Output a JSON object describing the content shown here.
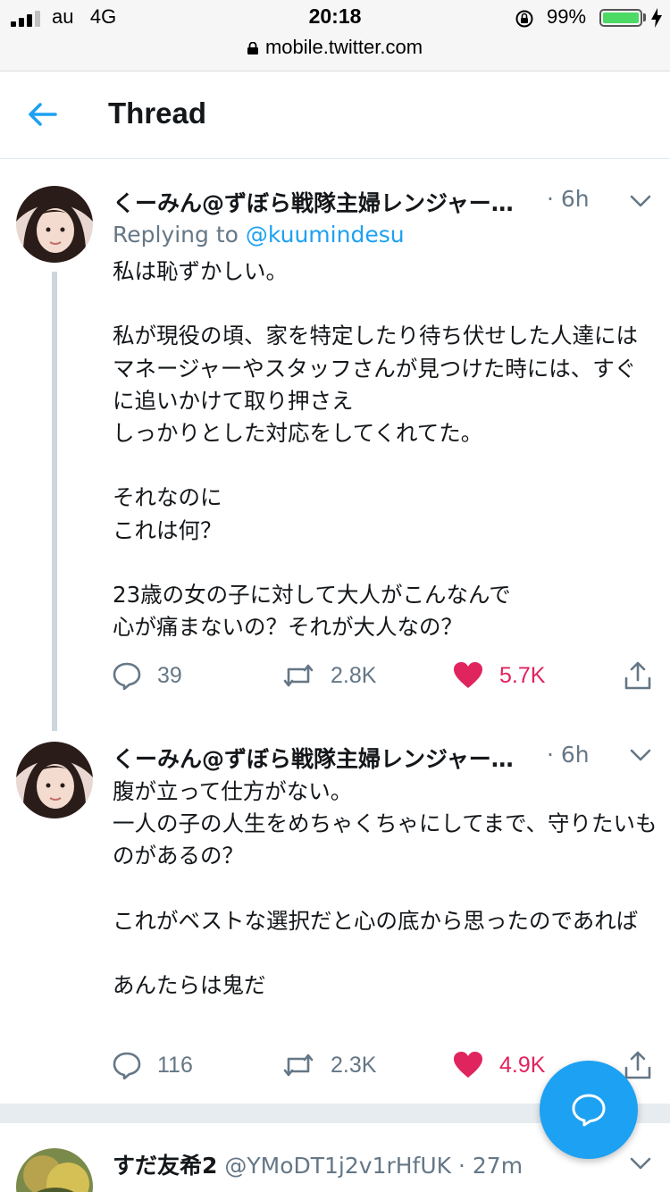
{
  "status_bar": {
    "carrier": "au",
    "network": "4G",
    "time": "20:18",
    "battery_percent": "99%",
    "battery_level": 0.99,
    "url": "mobile.twitter.com"
  },
  "header": {
    "title": "Thread",
    "back_icon": "arrow-left-icon"
  },
  "tweets": [
    {
      "name": "くーみん@ずぼら戦隊主婦レンジャー…",
      "time": "· 6h",
      "replying_prefix": "Replying to",
      "replying_handle": "@kuumindesu",
      "text": "私は恥ずかしい。\n\n私が現役の頃、家を特定したり待ち伏せした人達にはマネージャーやスタッフさんが見つけた時には、すぐに追いかけて取り押さえ\nしっかりとした対応をしてくれてた。\n\nそれなのに\nこれは何？\n\n23歳の女の子に対して大人がこんなんで\n心が痛まないの？それが大人なの？",
      "replies": "39",
      "retweets": "2.8K",
      "likes": "5.7K",
      "liked": true
    },
    {
      "name": "くーみん@ずぼら戦隊主婦レンジャー…",
      "time": "· 6h",
      "text": "腹が立って仕方がない。\n一人の子の人生をめちゃくちゃにしてまで、守りたいものがあるの？\n\nこれがベストな選択だと心の底から思ったのであれば\n\nあんたらは鬼だ",
      "replies": "116",
      "retweets": "2.3K",
      "likes": "4.9K",
      "liked": true
    },
    {
      "name": "すだ友希2",
      "handle": "@YMoDT1j2v1rHfUK",
      "time": "· 27m"
    }
  ],
  "colors": {
    "accent": "#1da1f2",
    "like": "#e0245e",
    "muted": "#657786",
    "thread_line": "#ccd6dd"
  },
  "fab": {
    "icon": "compose-reply-icon"
  }
}
